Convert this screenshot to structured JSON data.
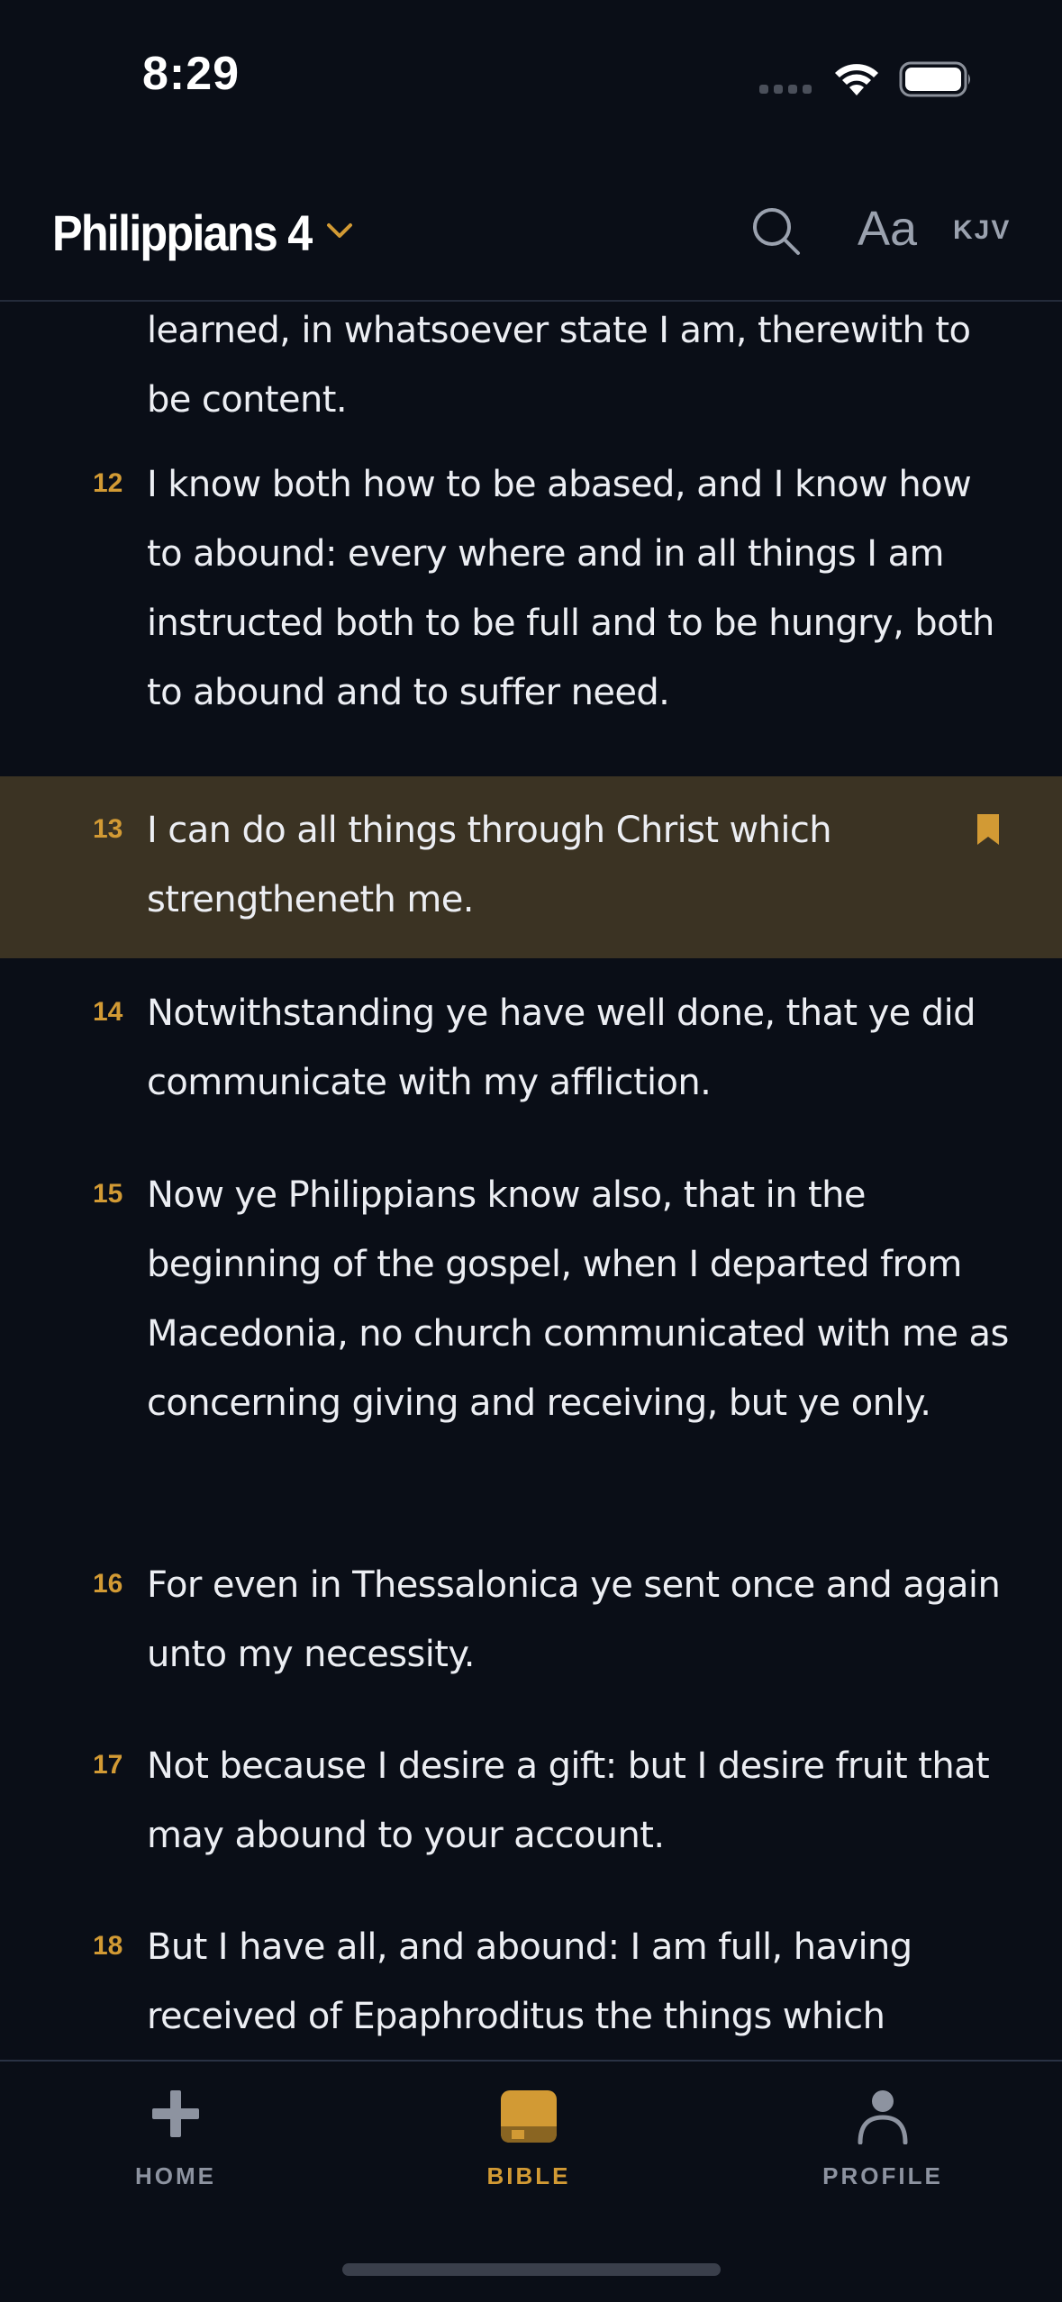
{
  "status_bar": {
    "time": "8:29"
  },
  "header": {
    "chapter_title": "Philippians 4",
    "font_size_label": "Aa",
    "version_label": "KJV"
  },
  "verses": [
    {
      "number": "",
      "text": "learned, in whatsoever state I am, therewith to be content.",
      "highlighted": false
    },
    {
      "number": "12",
      "text": "I know both how to be abased, and I know how to abound: every where and in all things I am instructed both to be full and to be hungry, both to abound and to suffer need.",
      "highlighted": false
    },
    {
      "number": "13",
      "text": "I can do all things through Christ which strengtheneth me.",
      "highlighted": true,
      "bookmarked": true
    },
    {
      "number": "14",
      "text": "Notwithstanding ye have well done, that ye did communicate with my affliction.",
      "highlighted": false
    },
    {
      "number": "15",
      "text": "Now ye Philippians know also, that in the beginning of the gospel, when I departed from Macedonia, no church communicated with me as concerning giving and receiving, but ye only.",
      "highlighted": false
    },
    {
      "number": "16",
      "text": "For even in Thessalonica ye sent once and again unto my necessity.",
      "highlighted": false
    },
    {
      "number": "17",
      "text": "Not because I desire a gift: but I desire fruit that may abound to your account.",
      "highlighted": false
    },
    {
      "number": "18",
      "text": "But I have all, and abound: I am full, having received of Epaphroditus the things which",
      "highlighted": false
    }
  ],
  "tab_bar": {
    "tabs": [
      {
        "label": "HOME",
        "icon": "plus-icon",
        "active": false
      },
      {
        "label": "BIBLE",
        "icon": "book-icon",
        "active": true
      },
      {
        "label": "PROFILE",
        "icon": "person-icon",
        "active": false
      }
    ]
  },
  "colors": {
    "background": "#0a0e17",
    "accent": "#d29a34",
    "highlight": "#3b3323",
    "text": "#eceef3",
    "muted": "#8d93a0"
  }
}
